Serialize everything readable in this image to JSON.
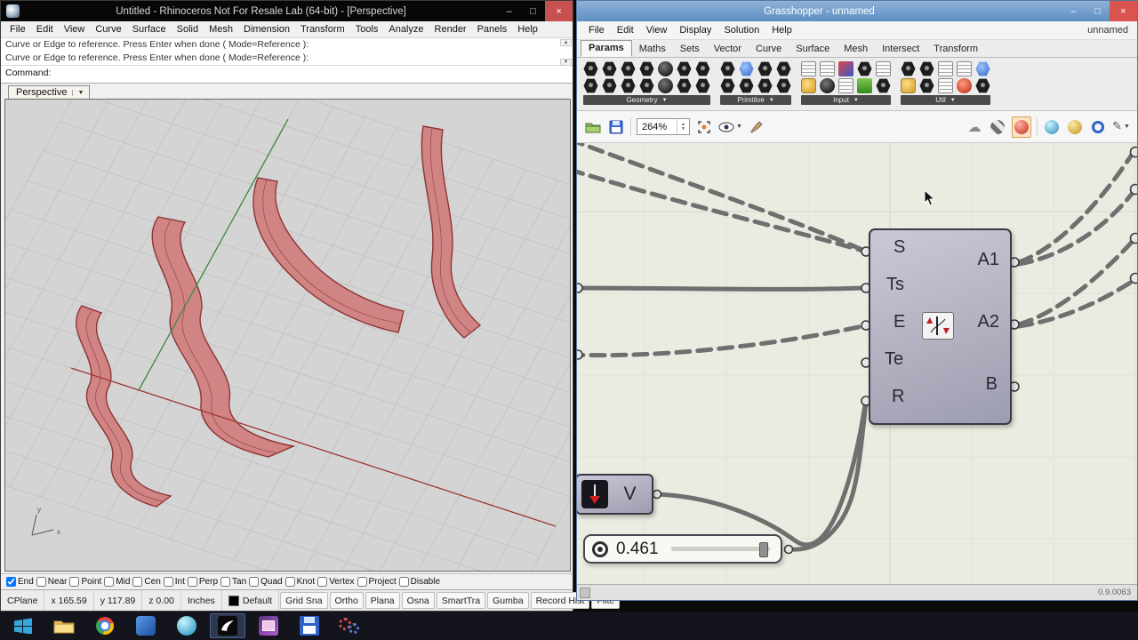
{
  "rhino": {
    "title": "Untitled - Rhinoceros Not For Resale Lab (64-bit) - [Perspective]",
    "menu": [
      "File",
      "Edit",
      "View",
      "Curve",
      "Surface",
      "Solid",
      "Mesh",
      "Dimension",
      "Transform",
      "Tools",
      "Analyze",
      "Render",
      "Panels",
      "Help"
    ],
    "command_history": [
      "Curve or Edge to reference. Press Enter when done ( Mode=Reference ):",
      "Curve or Edge to reference. Press Enter when done ( Mode=Reference ):"
    ],
    "command_prompt": "Command:",
    "viewport_tab": "Perspective",
    "osnap": [
      {
        "label": "End",
        "checked": true
      },
      {
        "label": "Near",
        "checked": false
      },
      {
        "label": "Point",
        "checked": false
      },
      {
        "label": "Mid",
        "checked": false
      },
      {
        "label": "Cen",
        "checked": false
      },
      {
        "label": "Int",
        "checked": false
      },
      {
        "label": "Perp",
        "checked": false
      },
      {
        "label": "Tan",
        "checked": false
      },
      {
        "label": "Quad",
        "checked": false
      },
      {
        "label": "Knot",
        "checked": false
      },
      {
        "label": "Vertex",
        "checked": false
      },
      {
        "label": "Project",
        "checked": false
      },
      {
        "label": "Disable",
        "checked": false
      }
    ],
    "status": [
      "CPlane",
      "x 165.59",
      "y 117.89",
      "z 0.00",
      "Inches",
      "Default",
      "Grid Sna",
      "Ortho",
      "Plana",
      "Osna",
      "SmartTra",
      "Gumba",
      "Record Hist",
      "Filte"
    ]
  },
  "grasshopper": {
    "title": "Grasshopper - unnamed",
    "menu": [
      "File",
      "Edit",
      "View",
      "Display",
      "Solution",
      "Help"
    ],
    "corner_label": "unnamed",
    "tabs": [
      "Params",
      "Maths",
      "Sets",
      "Vector",
      "Curve",
      "Surface",
      "Mesh",
      "Intersect",
      "Transform"
    ],
    "active_tab": "Params",
    "palette_groups": [
      "Geometry",
      "Primitive",
      "Input",
      "Util"
    ],
    "zoom_value": "264%",
    "component": {
      "inputs": [
        "S",
        "Ts",
        "E",
        "Te",
        "R"
      ],
      "outputs": [
        "A1",
        "A2",
        "B"
      ]
    },
    "vector_component_label": "V",
    "slider_value": "0.461",
    "version": "0.9.0063"
  },
  "taskbar": {
    "icons": [
      "start",
      "file-explorer",
      "chrome",
      "modeling-app",
      "drawing-app",
      "rhino-grasshopper-active",
      "photo-app",
      "backup-app",
      "settings-gears"
    ]
  },
  "colors": {
    "gh_canvas": "#ebebe1",
    "ribbon_fill": "#d08484",
    "ribbon_edge": "#8e3434",
    "wire": "#6f6f6f",
    "close_button": "#c75050"
  }
}
